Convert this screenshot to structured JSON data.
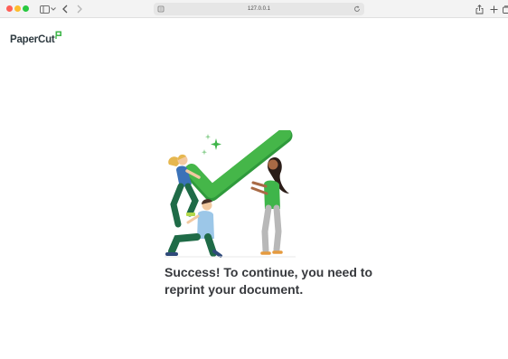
{
  "browser": {
    "url": "127.0.0.1"
  },
  "brand": {
    "name": "PaperCut",
    "accent_color": "#3fb54a"
  },
  "main": {
    "message": "Success! To continue, you need to reprint your document."
  },
  "icons": {
    "sidebar": "sidebar-icon",
    "back": "chevron-left-icon",
    "forward": "chevron-right-icon",
    "share": "share-icon",
    "new_tab": "plus-icon",
    "tabs": "tab-overview-icon",
    "reload": "reload-icon"
  }
}
